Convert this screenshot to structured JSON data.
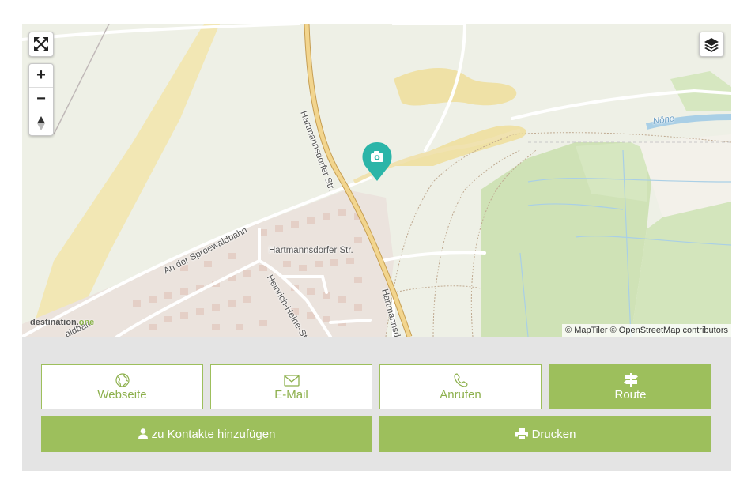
{
  "map": {
    "controls": {
      "fullscreen_icon": "fullscreen-icon",
      "zoom_in": "+",
      "zoom_out": "−",
      "compass_icon": "compass-icon",
      "layers_icon": "layers-icon"
    },
    "street_labels": {
      "hartmannsdorfer_north": "Hartmannsdorfer Str.",
      "an_der_spreewaldbahn": "An der Spreewaldbahn",
      "hartmannsdorfer_mid": "Hartmannsdorfer Str.",
      "heinrich_heine": "Heinrich-Heine-Str.",
      "hartmannsdorfer_south": "Hartmannsd",
      "partial_left": "aldbah"
    },
    "water_label": "Nöne",
    "marker_icon": "camera-icon",
    "marker_color": "#2bb5a8",
    "watermark": {
      "text": "destination.",
      "accent": "one"
    },
    "attribution": "© MapTiler © OpenStreetMap contributors"
  },
  "actions": {
    "website": "Webseite",
    "email": "E-Mail",
    "call": "Anrufen",
    "route": "Route",
    "add_contact": "zu Kontakte hinzufügen",
    "print": "Drucken"
  },
  "colors": {
    "accent": "#9dbf5c",
    "panel_background": "#e4e4e4"
  }
}
